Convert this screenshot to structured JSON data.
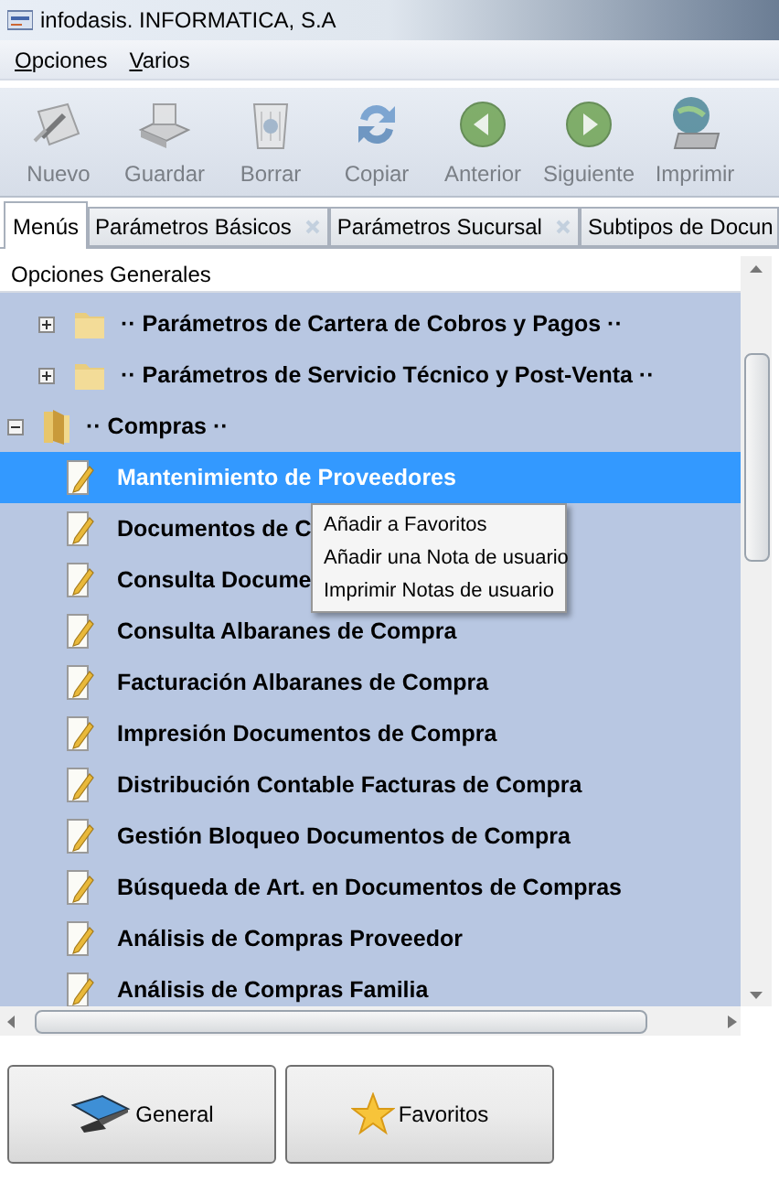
{
  "window": {
    "title": "infodasis. INFORMATICA, S.A"
  },
  "menu_bar": [
    {
      "label": "Opciones"
    },
    {
      "label": "Varios"
    }
  ],
  "toolbar": [
    {
      "kind": "new",
      "label": "Nuevo",
      "disabled": true
    },
    {
      "kind": "save",
      "label": "Guardar",
      "disabled": true
    },
    {
      "kind": "delete",
      "label": "Borrar",
      "disabled": true
    },
    {
      "kind": "copy",
      "label": "Copiar",
      "disabled": true
    },
    {
      "kind": "prev",
      "label": "Anterior",
      "disabled": true
    },
    {
      "kind": "next",
      "label": "Siguiente",
      "disabled": true
    },
    {
      "kind": "print",
      "label": "Imprimir",
      "disabled": true
    }
  ],
  "tabs": [
    {
      "label": "Menús",
      "selected": true,
      "closable": false
    },
    {
      "label": "Parámetros Básicos",
      "selected": false,
      "closable": true
    },
    {
      "label": "Parámetros Sucursal",
      "selected": false,
      "closable": true
    },
    {
      "label": "Subtipos de Docun",
      "selected": false,
      "closable": false
    }
  ],
  "panel": {
    "title": "Opciones Generales"
  },
  "tree": [
    {
      "kind": "subgroup",
      "label": "·· Parámetros de Cartera de Cobros y Pagos ··",
      "expanded": false
    },
    {
      "kind": "subgroup",
      "label": "·· Parámetros de Servicio Técnico y Post-Venta ··",
      "expanded": false
    },
    {
      "kind": "group",
      "label": "·· Compras ··",
      "expanded": true,
      "children": [
        {
          "label": "Mantenimiento de Proveedores",
          "selected": true
        },
        {
          "label": "Documentos de C",
          "selected": false
        },
        {
          "label": "Consulta Docume",
          "selected": false
        },
        {
          "label": "Consulta Albaranes de Compra",
          "selected": false
        },
        {
          "label": "Facturación Albaranes de Compra",
          "selected": false
        },
        {
          "label": "Impresión Documentos de Compra",
          "selected": false
        },
        {
          "label": "Distribución Contable Facturas de Compra",
          "selected": false
        },
        {
          "label": "Gestión Bloqueo Documentos de Compra",
          "selected": false
        },
        {
          "label": "Búsqueda de Art. en Documentos de Compras",
          "selected": false
        },
        {
          "label": "Análisis de Compras Proveedor",
          "selected": false
        },
        {
          "label": "Análisis de Compras Familia",
          "selected": false
        }
      ]
    }
  ],
  "context_menu": [
    "Añadir a Favoritos",
    "Añadir una Nota de usuario",
    "Imprimir Notas de usuario"
  ],
  "buttons": [
    {
      "kind": "general",
      "label": "General"
    },
    {
      "kind": "favorites",
      "label": "Favoritos"
    }
  ]
}
